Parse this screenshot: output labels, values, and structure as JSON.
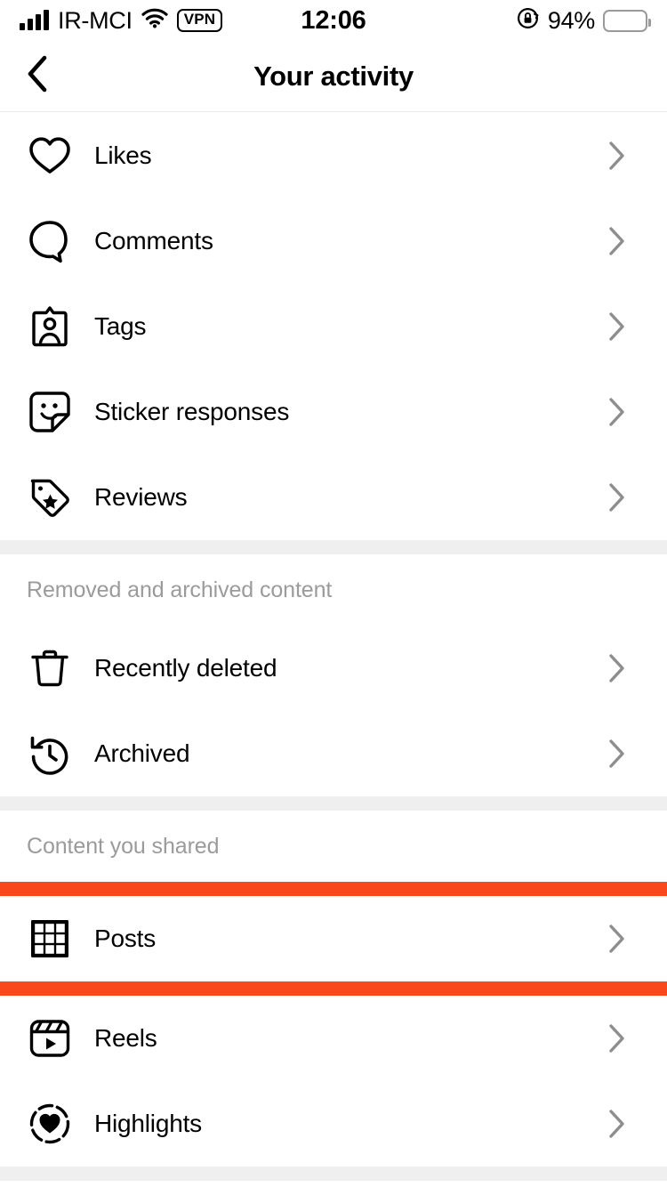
{
  "status_bar": {
    "carrier": "IR-MCI",
    "signal_icon": "cellular-signal-icon",
    "wifi_icon": "wifi-icon",
    "vpn_label": "VPN",
    "time": "12:06",
    "rotation_lock_icon": "rotation-lock-icon",
    "battery_percent": "94%",
    "battery_color": "#FFD60A",
    "battery_level": 94
  },
  "nav": {
    "back_icon": "chevron-left-icon",
    "title": "Your activity"
  },
  "sections": [
    {
      "header": null,
      "items": [
        {
          "label": "Likes",
          "icon": "heart-icon"
        },
        {
          "label": "Comments",
          "icon": "comment-bubble-icon"
        },
        {
          "label": "Tags",
          "icon": "tag-person-icon"
        },
        {
          "label": "Sticker responses",
          "icon": "sticker-smiley-icon"
        },
        {
          "label": "Reviews",
          "icon": "price-tag-star-icon"
        }
      ]
    },
    {
      "header": "Removed and archived content",
      "items": [
        {
          "label": "Recently deleted",
          "icon": "trash-icon"
        },
        {
          "label": "Archived",
          "icon": "clock-history-icon"
        }
      ]
    },
    {
      "header": "Content you shared",
      "items": [
        {
          "label": "Posts",
          "icon": "grid-icon",
          "highlighted": true
        },
        {
          "label": "Reels",
          "icon": "reels-clapper-icon"
        },
        {
          "label": "Highlights",
          "icon": "highlights-heart-icon"
        }
      ]
    }
  ],
  "colors": {
    "highlight": "#F8481C",
    "divider": "#efefef",
    "chevron": "#8e8e8e",
    "section_header_text": "#9b9b9b"
  },
  "chevron_icon": "chevron-right-icon"
}
